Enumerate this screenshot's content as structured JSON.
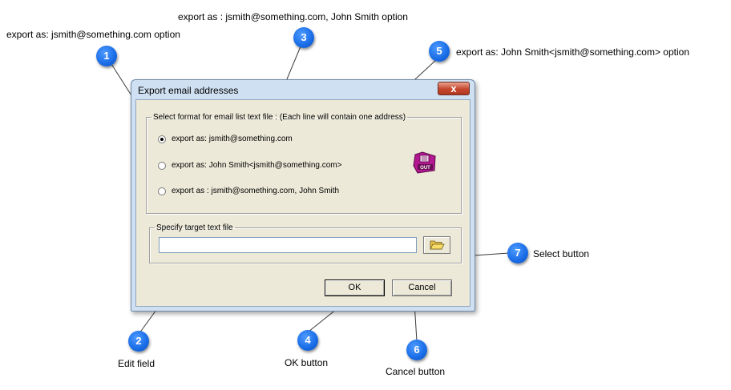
{
  "callouts": [
    {
      "number": "1",
      "text": "export as:  jsmith@something.com option"
    },
    {
      "number": "2",
      "text": "Edit field"
    },
    {
      "number": "3",
      "text": "export as :  jsmith@something.com, John Smith option"
    },
    {
      "number": "4",
      "text": "OK button"
    },
    {
      "number": "5",
      "text": "export as:   John Smith<jsmith@something.com> option"
    },
    {
      "number": "6",
      "text": "Cancel button"
    },
    {
      "number": "7",
      "text": "Select button"
    }
  ],
  "dialog": {
    "title": "Export email addresses",
    "close_label": "x",
    "format_group": {
      "legend": "Select format for email list text file : (Each line will contain one address)",
      "options": [
        {
          "label": "export as:  jsmith@something.com",
          "checked": true
        },
        {
          "label": "export as:   John Smith<jsmith@something.com>",
          "checked": false
        },
        {
          "label": "export as :  jsmith@something.com, John Smith",
          "checked": false
        }
      ]
    },
    "target_group": {
      "legend": "Specify target text file",
      "input_value": ""
    },
    "ok_label": "OK",
    "cancel_label": "Cancel"
  },
  "icons": {
    "export": "export-out-icon",
    "browse": "folder-open-icon"
  },
  "colors": {
    "badge": "#1b6fe8",
    "dialog_frame": "#cfe0f2",
    "dialog_client": "#ece9d8",
    "close_button": "#c5462c"
  }
}
